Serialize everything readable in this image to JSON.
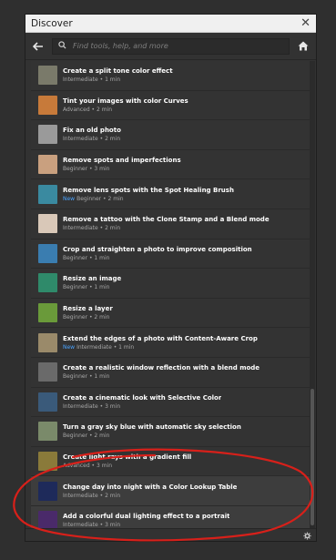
{
  "window": {
    "title": "Discover",
    "close_icon": "close-icon"
  },
  "toolbar": {
    "back_icon": "arrow-left-icon",
    "search_placeholder": "Find tools, help, and more",
    "home_icon": "home-icon"
  },
  "items": [
    {
      "title": "Create a split tone color effect",
      "level": "Intermediate",
      "time": "1 min",
      "new": "",
      "thumb": "#7a7a6a"
    },
    {
      "title": "Tint your images with color Curves",
      "level": "Advanced",
      "time": "2 min",
      "new": "",
      "thumb": "#c77a3a"
    },
    {
      "title": "Fix an old photo",
      "level": "Intermediate",
      "time": "2 min",
      "new": "",
      "thumb": "#9a9a9a"
    },
    {
      "title": "Remove spots and imperfections",
      "level": "Beginner",
      "time": "3 min",
      "new": "",
      "thumb": "#c9a07f"
    },
    {
      "title": "Remove lens spots with the Spot Healing Brush",
      "level": "Beginner",
      "time": "2 min",
      "new": "New",
      "thumb": "#3a8aa0"
    },
    {
      "title": "Remove a tattoo with the Clone Stamp and a Blend mode",
      "level": "Intermediate",
      "time": "2 min",
      "new": "",
      "thumb": "#d9c8b8"
    },
    {
      "title": "Crop and straighten a photo to improve composition",
      "level": "Beginner",
      "time": "1 min",
      "new": "",
      "thumb": "#3a7db0"
    },
    {
      "title": "Resize an image",
      "level": "Beginner",
      "time": "1 min",
      "new": "",
      "thumb": "#2f8a6a"
    },
    {
      "title": "Resize a layer",
      "level": "Beginner",
      "time": "2 min",
      "new": "",
      "thumb": "#6a9a3a"
    },
    {
      "title": "Extend the edges of a photo with Content-Aware Crop",
      "level": "Intermediate",
      "time": "1 min",
      "new": "New",
      "thumb": "#9a8a6a"
    },
    {
      "title": "Create a realistic window reflection with a blend mode",
      "level": "Beginner",
      "time": "1 min",
      "new": "",
      "thumb": "#6a6a6a"
    },
    {
      "title": "Create a cinematic look with Selective Color",
      "level": "Intermediate",
      "time": "3 min",
      "new": "",
      "thumb": "#3a5a7a"
    },
    {
      "title": "Turn a gray sky blue with automatic sky selection",
      "level": "Beginner",
      "time": "2 min",
      "new": "",
      "thumb": "#7a8a6a"
    },
    {
      "title": "Create light rays with a gradient fill",
      "level": "Advanced",
      "time": "3 min",
      "new": "",
      "thumb": "#8a7a3a"
    },
    {
      "title": "Change day into night with a Color Lookup Table",
      "level": "Intermediate",
      "time": "2 min",
      "new": "",
      "thumb": "#1e2a5a"
    },
    {
      "title": "Add a colorful dual lighting effect to a portrait",
      "level": "Intermediate",
      "time": "3 min",
      "new": "",
      "thumb": "#4a2a6a"
    }
  ],
  "footer": {
    "settings_icon": "gear-icon"
  },
  "colors": {
    "annotation": "#d8201a",
    "new_badge": "#4aa3ff"
  }
}
